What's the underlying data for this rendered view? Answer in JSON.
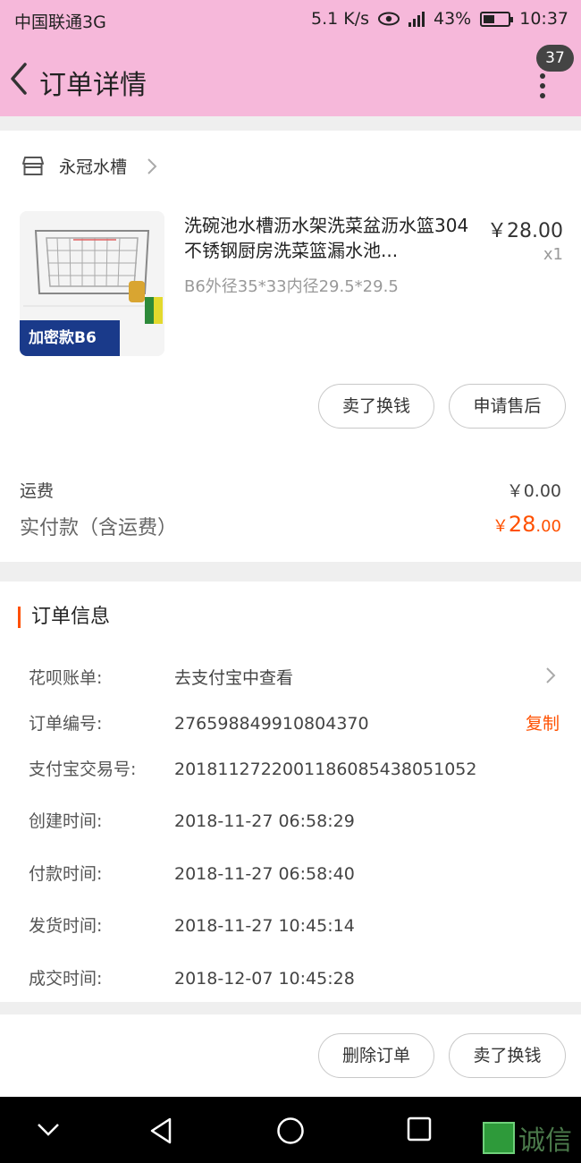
{
  "status_bar": {
    "carrier": "中国联通3G",
    "speed": "5.1 K/s",
    "battery": "43%",
    "time": "10:37"
  },
  "header": {
    "title": "订单详情",
    "badge_count": "37"
  },
  "shop": {
    "name": "永冠水槽"
  },
  "goods": {
    "name": "洗碗池水槽沥水架洗菜盆沥水篮304不锈钢厨房洗菜篮漏水池...",
    "price": "￥28.00",
    "quantity": "x1",
    "spec": "B6外径35*33内径29.5*29.5",
    "thumb_label": "加密款B6"
  },
  "goods_actions": {
    "sell_label": "卖了换钱",
    "after_sale_label": "申请售后"
  },
  "summary": {
    "shipping_label": "运费",
    "shipping_value": "￥0.00",
    "paid_label": "实付款（含运费）",
    "paid_currency": "￥",
    "paid_integer": "28",
    "paid_decimal": ".00"
  },
  "order_info": {
    "section_title": "订单信息",
    "copy_label": "复制",
    "rows": [
      {
        "key": "花呗账单:",
        "value": "去支付宝中查看"
      },
      {
        "key": "订单编号:",
        "value": "276598849910804370"
      },
      {
        "key": "支付宝交易号:",
        "value": "2018112722001186085438051052"
      },
      {
        "key": "创建时间:",
        "value": "2018-11-27 06:58:29"
      },
      {
        "key": "付款时间:",
        "value": "2018-11-27 06:58:40"
      },
      {
        "key": "发货时间:",
        "value": "2018-11-27 10:45:14"
      },
      {
        "key": "成交时间:",
        "value": "2018-12-07 10:45:28"
      }
    ]
  },
  "bottom_actions": {
    "delete_label": "删除订单",
    "sell_label": "卖了换钱"
  },
  "watermark": {
    "text": "诚信"
  },
  "colors": {
    "header_bg": "#f6b8da",
    "accent": "#ff5000"
  }
}
